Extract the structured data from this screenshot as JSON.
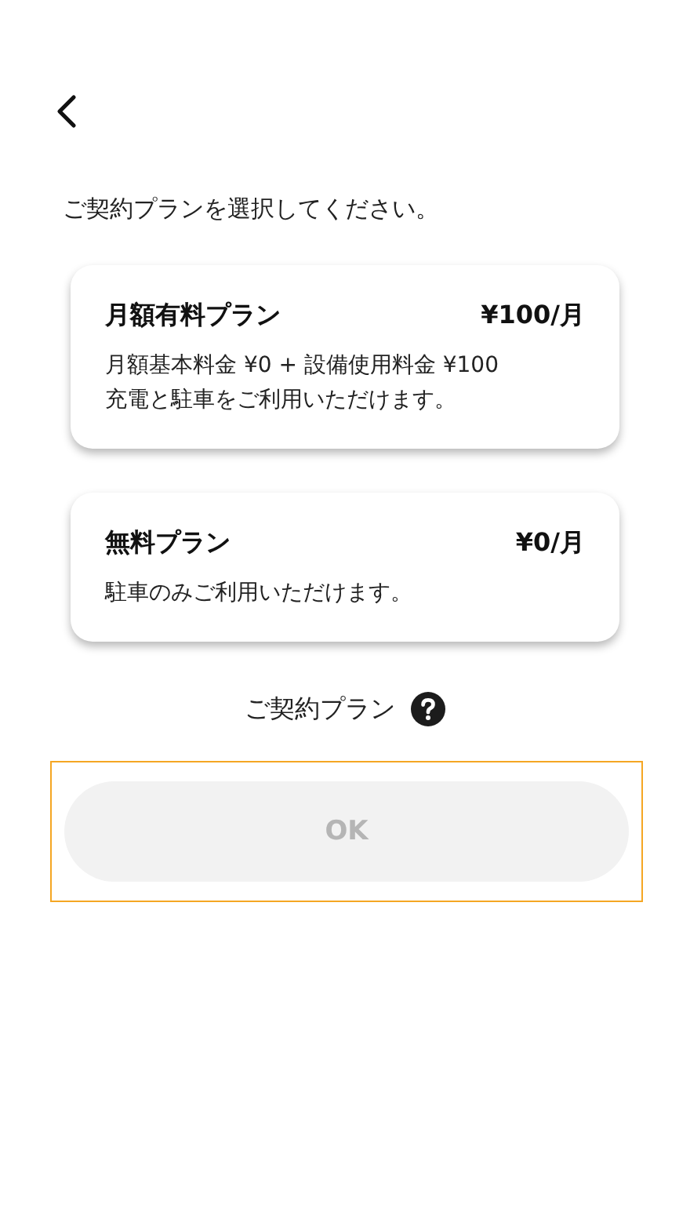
{
  "prompt": "ご契約プランを選択してください。",
  "plans": [
    {
      "name": "月額有料プラン",
      "price": "¥100/月",
      "lines": [
        "月額基本料金 ¥0 + 設備使用料金 ¥100",
        "充電と駐車をご利用いただけます。"
      ]
    },
    {
      "name": "無料プラン",
      "price": "¥0/月",
      "lines": [
        "駐車のみご利用いただけます。"
      ]
    }
  ],
  "current_plan": {
    "label": "ご契約プラン"
  },
  "ok_button": {
    "label": "OK",
    "disabled": true,
    "focused": true
  }
}
